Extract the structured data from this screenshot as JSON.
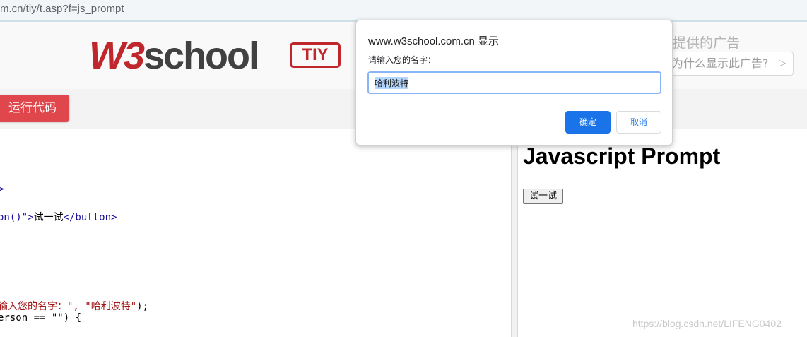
{
  "browser": {
    "url": "m.cn/tiy/t.asp?f=js_prompt"
  },
  "header": {
    "logo_w3": "W3",
    "logo_school": "school",
    "tiy_badge": "TIY",
    "ad_label": "提供的广告",
    "ad_why": "为什么显示此广告?",
    "ad_icon": "play-triangle-icon"
  },
  "toolbar": {
    "run_label": "运行代码"
  },
  "code": {
    "line_1_tag": ">",
    "line_2_tag": "on()\">",
    "line_2_text": "试一试",
    "line_2_close": "</button>",
    "line_3_str": "输入您的名字：\", \"哈利波特\"",
    "line_3_tail": ");",
    "line_4_text": "erson == \"\") {"
  },
  "result": {
    "heading": "Javascript Prompt",
    "button_label": "试一试"
  },
  "dialog": {
    "title": "www.w3school.com.cn 显示",
    "message": "请输入您的名字：",
    "input_value": "哈利波特",
    "ok_label": "确定",
    "cancel_label": "取消"
  },
  "watermark": "https://blog.csdn.net/LIFENG0402"
}
